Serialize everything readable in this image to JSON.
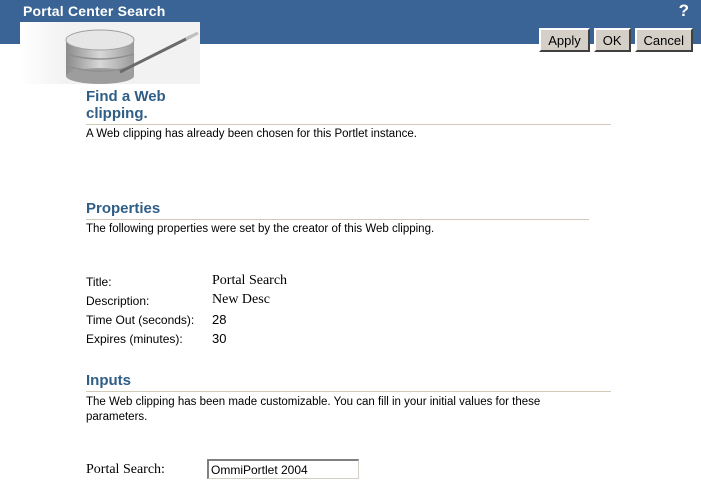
{
  "header": {
    "title": "Portal Center Search",
    "help_label": "?"
  },
  "toolbar": {
    "apply_label": "Apply",
    "ok_label": "OK",
    "cancel_label": "Cancel"
  },
  "find": {
    "title_line1": "Find a Web",
    "title_line2": "clipping.",
    "description": "A Web clipping has already been chosen for this Portlet instance."
  },
  "properties": {
    "title": "Properties",
    "description": "The following properties were set by the creator of this Web clipping.",
    "rows": [
      {
        "label": "Title:",
        "value": "Portal Search"
      },
      {
        "label": "Description:",
        "value": "New Desc"
      },
      {
        "label": "Time Out (seconds):",
        "value": "28"
      },
      {
        "label": "Expires (minutes):",
        "value": "30"
      }
    ]
  },
  "inputs": {
    "title": "Inputs",
    "description_line1": "The Web clipping has been made customizable. You can fill in your initial values for these",
    "description_line2": "parameters.",
    "field_label": "Portal Search:",
    "field_value": "OmmiPortlet 2004"
  },
  "colors": {
    "title_bar": "#3a6495",
    "section_title": "#2f5e86"
  }
}
